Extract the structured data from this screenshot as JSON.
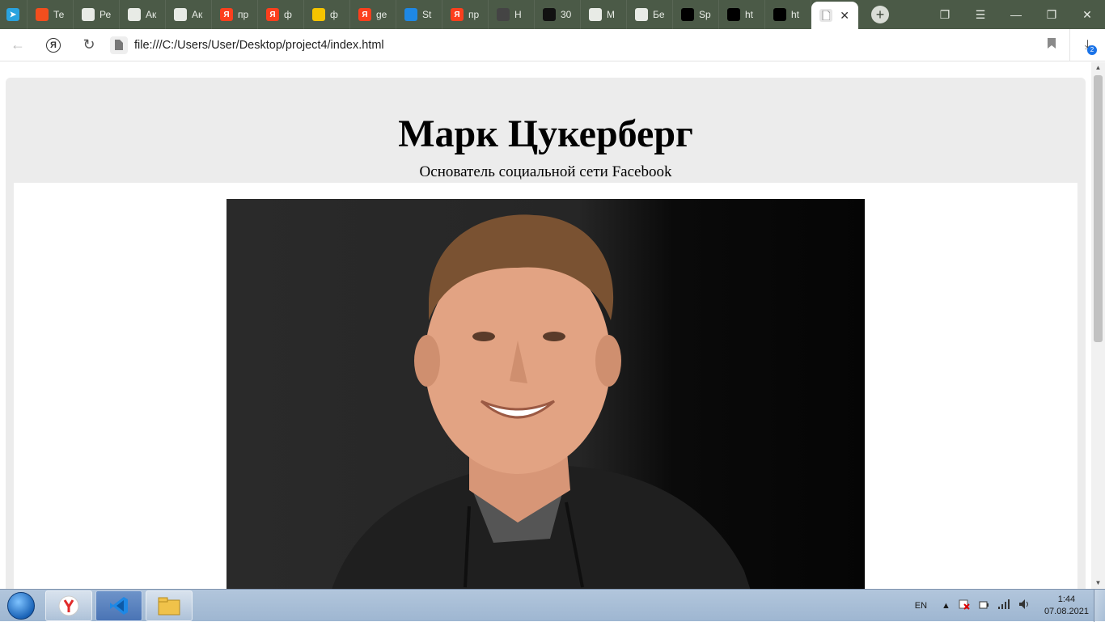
{
  "browser": {
    "tabs": [
      {
        "label": "",
        "icon": "telegram-icon",
        "color": "#2aa3df"
      },
      {
        "label": "Те",
        "icon": "figma-icon",
        "color": "#f24e1e"
      },
      {
        "label": "Ре",
        "icon": "document-icon",
        "color": "#6b7a67"
      },
      {
        "label": "Ак",
        "icon": "document-icon",
        "color": "#6b7a67"
      },
      {
        "label": "Ак",
        "icon": "page-icon",
        "color": "#6b7a67"
      },
      {
        "label": "пр",
        "icon": "yandex-icon",
        "color": "#fc3f1d"
      },
      {
        "label": "ф",
        "icon": "yandex-icon",
        "color": "#fc3f1d"
      },
      {
        "label": "ф",
        "icon": "image-icon",
        "color": "#f5c400"
      },
      {
        "label": "ge",
        "icon": "yandex-icon",
        "color": "#fc3f1d"
      },
      {
        "label": "St",
        "icon": "drive-icon",
        "color": "#1e88e5"
      },
      {
        "label": "пр",
        "icon": "yandex-icon",
        "color": "#fc3f1d"
      },
      {
        "label": "Н",
        "icon": "avatar-icon",
        "color": "#444444"
      },
      {
        "label": "30",
        "icon": "hh-icon",
        "color": "#111111"
      },
      {
        "label": "М",
        "icon": "document-icon",
        "color": "#6b7a67"
      },
      {
        "label": "Бе",
        "icon": "page-icon",
        "color": "#6b7a67"
      },
      {
        "label": "Sp",
        "icon": "cube-icon",
        "color": "#000000"
      },
      {
        "label": "ht",
        "icon": "cube-icon",
        "color": "#000000"
      },
      {
        "label": "ht",
        "icon": "cube-icon",
        "color": "#000000"
      }
    ],
    "active_tab": {
      "label": "",
      "icon": "document-icon"
    },
    "new_tab": "+",
    "url": "file:///C:/Users/User/Desktop/project4/index.html",
    "downloads_count": "2"
  },
  "page": {
    "title": "Марк Цукерберг",
    "subtitle": "Основатель социальной сети Facebook",
    "photo_alt": "portrait photo"
  },
  "taskbar": {
    "apps": [
      {
        "icon": "yandex-browser-icon",
        "color": "#e12b2b"
      },
      {
        "icon": "vscode-icon",
        "color": "#1e88e5"
      },
      {
        "icon": "file-explorer-icon",
        "color": "#f0c24a"
      }
    ],
    "language": "EN",
    "time": "1:44",
    "date": "07.08.2021"
  }
}
